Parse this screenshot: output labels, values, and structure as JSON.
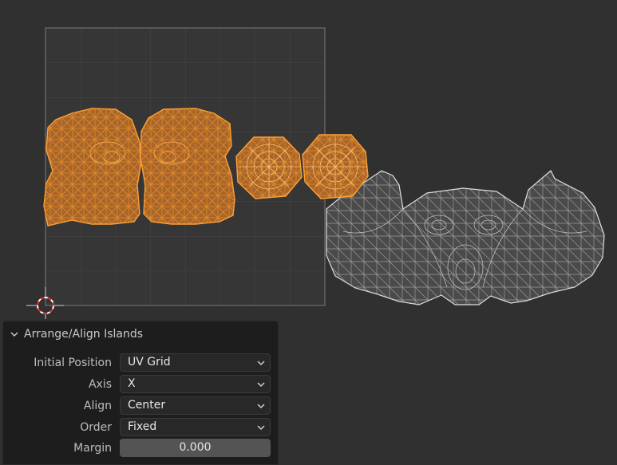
{
  "panel": {
    "title": "Arrange/Align Islands",
    "fields": [
      {
        "label": "Initial Position",
        "value": "UV Grid",
        "kind": "dropdown"
      },
      {
        "label": "Axis",
        "value": "X",
        "kind": "dropdown"
      },
      {
        "label": "Align",
        "value": "Center",
        "kind": "dropdown"
      },
      {
        "label": "Order",
        "value": "Fixed",
        "kind": "dropdown"
      },
      {
        "label": "Margin",
        "value": "0.000",
        "kind": "number"
      }
    ]
  },
  "colors": {
    "background": "#303030",
    "selected_island_fill": "#b06a2a",
    "selected_island_edge": "#ffa033",
    "unselected_island_fill": "#4a4a4a",
    "unselected_island_edge": "#c8c8c8",
    "grid_line": "#4a4a4a",
    "uv_bounds": "#7a7a7a"
  },
  "icons": {
    "cursor": "2d-cursor-icon",
    "collapse": "chevron-down-icon",
    "dropdown": "chevron-down-icon"
  }
}
